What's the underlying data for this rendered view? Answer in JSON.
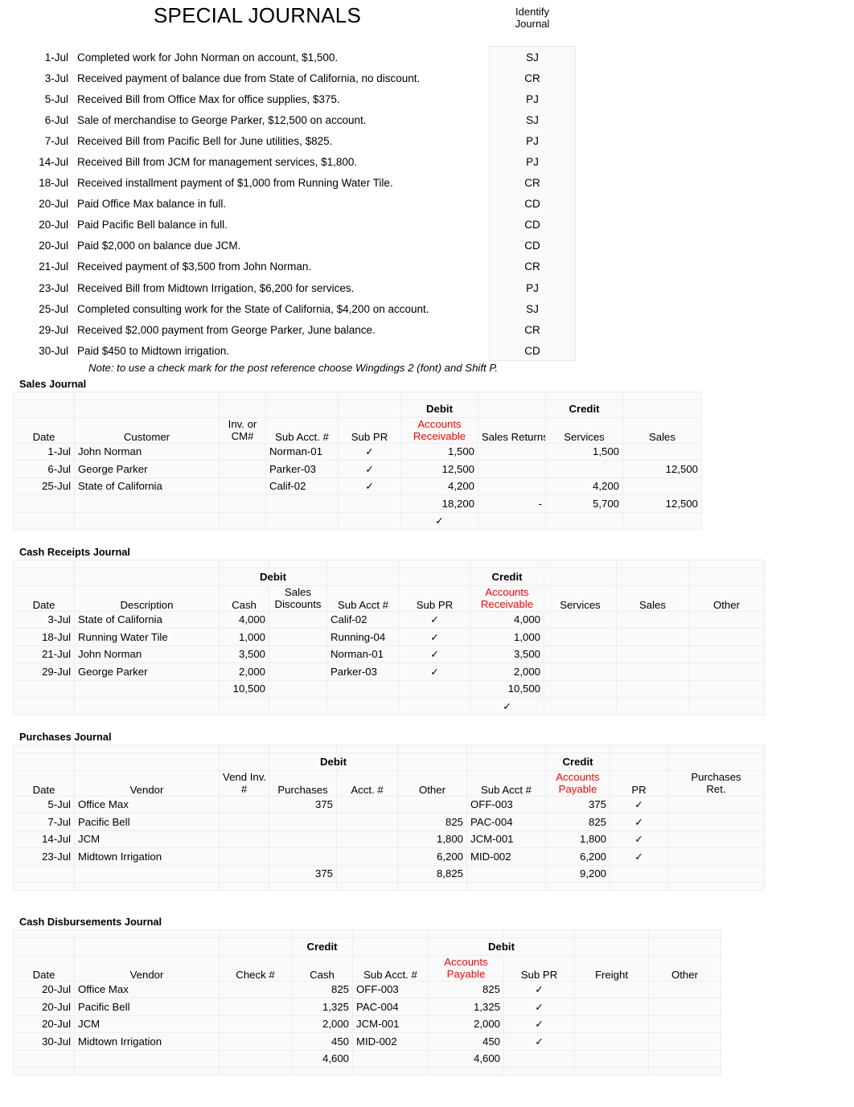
{
  "header": {
    "title": "SPECIAL JOURNALS",
    "identify_label_line1": "Identify",
    "identify_label_line2": "Journal"
  },
  "transactions": [
    {
      "date": "1-Jul",
      "description": "Completed work for John Norman on account, $1,500.",
      "journal": "SJ"
    },
    {
      "date": "3-Jul",
      "description": "Received payment of balance due from State of California, no discount.",
      "journal": "CR"
    },
    {
      "date": "5-Jul",
      "description": "Received Bill from Office Max for office supplies, $375.",
      "journal": "PJ"
    },
    {
      "date": "6-Jul",
      "description": "Sale of merchandise to George Parker, $12,500 on account.",
      "journal": "SJ"
    },
    {
      "date": "7-Jul",
      "description": "Received Bill from Pacific Bell for June utilities, $825.",
      "journal": "PJ"
    },
    {
      "date": "14-Jul",
      "description": "Received Bill from JCM for management services, $1,800.",
      "journal": "PJ"
    },
    {
      "date": "18-Jul",
      "description": "Received installment payment of $1,000 from Running Water Tile.",
      "journal": "CR"
    },
    {
      "date": "20-Jul",
      "description": "Paid Office Max balance in full.",
      "journal": "CD"
    },
    {
      "date": "20-Jul",
      "description": "Paid Pacific Bell balance in full.",
      "journal": "CD"
    },
    {
      "date": "20-Jul",
      "description": "Paid $2,000 on balance due JCM.",
      "journal": "CD"
    },
    {
      "date": "21-Jul",
      "description": "Received payment of $3,500 from John Norman.",
      "journal": "CR"
    },
    {
      "date": "23-Jul",
      "description": "Received Bill from Midtown Irrigation, $6,200 for services.",
      "journal": "PJ"
    },
    {
      "date": "25-Jul",
      "description": "Completed consulting work for the State of California, $4,200 on account.",
      "journal": "SJ"
    },
    {
      "date": "29-Jul",
      "description": "Received $2,000 payment from George Parker, June balance.",
      "journal": "CR"
    },
    {
      "date": "30-Jul",
      "description": "Paid $450 to Midtown irrigation.",
      "journal": "CD"
    }
  ],
  "note": "Note: to use a check mark for the post reference choose Wingdings 2 (font) and Shift P.",
  "sales_journal": {
    "title": "Sales Journal",
    "group_headers": {
      "debit": "Debit",
      "credit": "Credit"
    },
    "headers": {
      "date": "Date",
      "customer": "Customer",
      "inv_cm_line1": "Inv. or",
      "inv_cm_line2": "CM#",
      "sub_acct": "Sub Acct. #",
      "sub_pr": "Sub PR",
      "ar_line1": "Accounts",
      "ar_line2": "Receivable",
      "sales_returns": "Sales Returns",
      "services": "Services",
      "sales": "Sales"
    },
    "rows": [
      {
        "date": "1-Jul",
        "customer": "John Norman",
        "inv": "",
        "sub_acct": "Norman-01",
        "sub_pr": "✓",
        "ar": "1,500",
        "sales_returns": "",
        "services": "1,500",
        "sales": ""
      },
      {
        "date": "6-Jul",
        "customer": "George Parker",
        "inv": "",
        "sub_acct": "Parker-03",
        "sub_pr": "✓",
        "ar": "12,500",
        "sales_returns": "",
        "services": "",
        "sales": "12,500"
      },
      {
        "date": "25-Jul",
        "customer": "State of California",
        "inv": "",
        "sub_acct": "Calif-02",
        "sub_pr": "✓",
        "ar": "4,200",
        "sales_returns": "",
        "services": "4,200",
        "sales": ""
      }
    ],
    "totals": {
      "ar": "18,200",
      "sales_returns": "-",
      "services": "5,700",
      "sales": "12,500"
    },
    "post_check": "✓"
  },
  "cash_receipts_journal": {
    "title": "Cash Receipts Journal",
    "group_headers": {
      "debit": "Debit",
      "credit": "Credit"
    },
    "headers": {
      "date": "Date",
      "description": "Description",
      "cash": "Cash",
      "sales_disc_line1": "Sales",
      "sales_disc_line2": "Discounts",
      "sub_acct": "Sub Acct #",
      "sub_pr": "Sub PR",
      "ar_line1": "Accounts",
      "ar_line2": "Receivable",
      "services": "Services",
      "sales": "Sales",
      "other": "Other"
    },
    "rows": [
      {
        "date": "3-Jul",
        "description": "State of California",
        "cash": "4,000",
        "sales_discounts": "",
        "sub_acct": "Calif-02",
        "sub_pr": "✓",
        "ar": "4,000",
        "services": "",
        "sales": "",
        "other": ""
      },
      {
        "date": "18-Jul",
        "description": "Running Water Tile",
        "cash": "1,000",
        "sales_discounts": "",
        "sub_acct": "Running-04",
        "sub_pr": "✓",
        "ar": "1,000",
        "services": "",
        "sales": "",
        "other": ""
      },
      {
        "date": "21-Jul",
        "description": "John Norman",
        "cash": "3,500",
        "sales_discounts": "",
        "sub_acct": "Norman-01",
        "sub_pr": "✓",
        "ar": "3,500",
        "services": "",
        "sales": "",
        "other": ""
      },
      {
        "date": "29-Jul",
        "description": "George Parker",
        "cash": "2,000",
        "sales_discounts": "",
        "sub_acct": "Parker-03",
        "sub_pr": "✓",
        "ar": "2,000",
        "services": "",
        "sales": "",
        "other": ""
      }
    ],
    "totals": {
      "cash": "10,500",
      "sales_discounts": "",
      "ar": "10,500",
      "services": "",
      "sales": "",
      "other": ""
    },
    "post_check": "✓"
  },
  "purchases_journal": {
    "title": "Purchases Journal",
    "group_headers": {
      "debit": "Debit",
      "credit": "Credit"
    },
    "headers": {
      "date": "Date",
      "vendor": "Vendor",
      "vend_inv_line1": "Vend Inv.",
      "vend_inv_line2": "#",
      "purchases": "Purchases",
      "acct": "Acct. #",
      "other": "Other",
      "sub_acct": "Sub Acct #",
      "ap_line1": "Accounts",
      "ap_line2": "Payable",
      "pr": "PR",
      "purch_ret_line1": "Purchases",
      "purch_ret_line2": "Ret."
    },
    "rows": [
      {
        "date": "5-Jul",
        "vendor": "Office Max",
        "vend_inv": "",
        "purchases": "375",
        "acct": "",
        "other": "",
        "sub_acct": "OFF-003",
        "ap": "375",
        "pr": "✓",
        "purch_ret": ""
      },
      {
        "date": "7-Jul",
        "vendor": "Pacific Bell",
        "vend_inv": "",
        "purchases": "",
        "acct": "",
        "other": "825",
        "sub_acct": "PAC-004",
        "ap": "825",
        "pr": "✓",
        "purch_ret": ""
      },
      {
        "date": "14-Jul",
        "vendor": "JCM",
        "vend_inv": "",
        "purchases": "",
        "acct": "",
        "other": "1,800",
        "sub_acct": "JCM-001",
        "ap": "1,800",
        "pr": "✓",
        "purch_ret": ""
      },
      {
        "date": "23-Jul",
        "vendor": "Midtown Irrigation",
        "vend_inv": "",
        "purchases": "",
        "acct": "",
        "other": "6,200",
        "sub_acct": "MID-002",
        "ap": "6,200",
        "pr": "✓",
        "purch_ret": ""
      }
    ],
    "totals": {
      "purchases": "375",
      "other": "8,825",
      "ap": "9,200"
    }
  },
  "cash_disbursements_journal": {
    "title": "Cash Disbursements Journal",
    "group_headers": {
      "credit": "Credit",
      "debit": "Debit"
    },
    "headers": {
      "date": "Date",
      "vendor": "Vendor",
      "check": "Check #",
      "cash": "Cash",
      "sub_acct": "Sub Acct. #",
      "ap_line1": "Accounts",
      "ap_line2": "Payable",
      "sub_pr": "Sub PR",
      "freight": "Freight",
      "other": "Other"
    },
    "rows": [
      {
        "date": "20-Jul",
        "vendor": "Office Max",
        "check": "",
        "cash": "825",
        "sub_acct": "OFF-003",
        "ap": "825",
        "sub_pr": "✓",
        "freight": "",
        "other": ""
      },
      {
        "date": "20-Jul",
        "vendor": "Pacific Bell",
        "check": "",
        "cash": "1,325",
        "sub_acct": "PAC-004",
        "ap": "1,325",
        "sub_pr": "✓",
        "freight": "",
        "other": ""
      },
      {
        "date": "20-Jul",
        "vendor": "JCM",
        "check": "",
        "cash": "2,000",
        "sub_acct": "JCM-001",
        "ap": "2,000",
        "sub_pr": "✓",
        "freight": "",
        "other": ""
      },
      {
        "date": "30-Jul",
        "vendor": "Midtown Irrigation",
        "check": "",
        "cash": "450",
        "sub_acct": "MID-002",
        "ap": "450",
        "sub_pr": "✓",
        "freight": "",
        "other": ""
      }
    ],
    "totals": {
      "cash": "4,600",
      "ap": "4,600"
    }
  },
  "colors": {
    "control_account_red": "#ff0000",
    "grid_line": "#ededed",
    "cell_fill": "#fafafa"
  }
}
